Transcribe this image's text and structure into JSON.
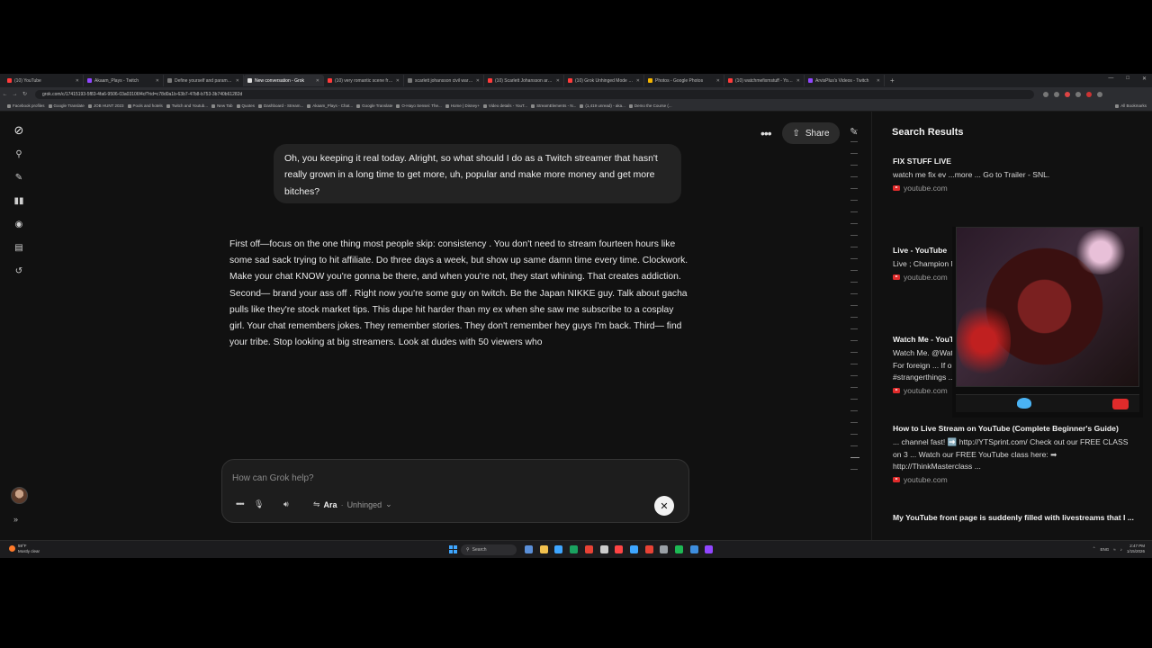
{
  "browser": {
    "tabs": [
      {
        "title": "(10) YouTube",
        "color": "#ff3b3b",
        "active": false
      },
      {
        "title": "Akaam_Plays - Twitch",
        "color": "#9146ff",
        "active": false
      },
      {
        "title": "Define yourself and parameter...",
        "color": "#7a7a7a",
        "active": false
      },
      {
        "title": "New conversation - Grok",
        "color": "#dddddd",
        "active": true
      },
      {
        "title": "(10) very romantic scene from...",
        "color": "#ff3b3b",
        "active": false
      },
      {
        "title": "scarlett johansson civil war pic...",
        "color": "#7a7a7a",
        "active": false
      },
      {
        "title": "(10) Scarlett Johansson arrive...",
        "color": "#ff3b3b",
        "active": false
      },
      {
        "title": "(10) Grok Unhinged Mode in ...",
        "color": "#ff3b3b",
        "active": false
      },
      {
        "title": "Photos - Google Photos",
        "color": "#f4b400",
        "active": false
      },
      {
        "title": "(10) watchmefixmstuff - YouTu...",
        "color": "#ff3b3b",
        "active": false
      },
      {
        "title": "ArvisPlus's Videos - Twitch",
        "color": "#9146ff",
        "active": false
      }
    ],
    "new_tab": "+",
    "url": "grok.com/c/17415193-5f83-4fa6-9506-03a03106f4cf?rid=c78d0a1b-63b7-47b8-b753-3b740b61282d",
    "bookmarks": [
      "Facebook profiles",
      "Google Translate",
      "JOB HUNT 2023",
      "Pools and hotels",
      "Twitch and Youtub...",
      "New Tab",
      "Quotes",
      "Dashboard - Stream...",
      "Akaam_Plays - Chat...",
      "Google Translate",
      "O-Hayo Sensei: The...",
      "Home | Disney+",
      "Video details - YouT...",
      "StreamElements - N...",
      "(1,419 unread) - aka...",
      "Demo the Course (..."
    ],
    "all_bookmarks": "All Bookmarks"
  },
  "header": {
    "more_label": "•••",
    "share_label": "Share"
  },
  "conversation": {
    "user_message": "Oh, you keeping it real today. Alright, so what should I do as a Twitch streamer that hasn't really grown in a long time to get more, uh, popular and make more money and get more bitches?",
    "assistant_message": "First off—focus on the one thing most people skip: consistency . You don't need to stream fourteen hours like some sad sack trying to hit affiliate. Do three days a week, but show up same damn time every time. Clockwork. Make your chat KNOW you're gonna be there, and when you're not, they start whining. That creates addiction. Second— brand your ass off . Right now you're some guy on twitch. Be the Japan NIKKE guy. Talk about gacha pulls like they're stock market tips. This dupe hit harder than my ex when she saw me subscribe to a cosplay girl. Your chat remembers jokes. They remember stories. They don't remember hey guys I'm back. Third— find your tribe. Stop looking at big streamers. Look at dudes with 50 viewers who"
  },
  "composer": {
    "placeholder": "How can Grok help?",
    "voice_name": "Ara",
    "voice_mode": "Unhinged"
  },
  "search_panel": {
    "title": "Search Results",
    "results": [
      {
        "title": "FIX STUFF LIVE",
        "snippet": "watch me fix ev ...more ... Go to Trailer - SNL.",
        "source": "youtube.com"
      },
      {
        "title": "Live - YouTube",
        "snippet": "Live ; Champion NASCAR. 14K w news conference:",
        "source": "youtube.com"
      },
      {
        "title": "Watch Me - YouTube",
        "snippet": "Watch Me. @WatchMeOff. 14.2M subscribers•1.9K videos. Contacts For foreign ... If only Stranger Things happened in the real world! #strangerthings ...",
        "source": "youtube.com"
      },
      {
        "title": "How to Live Stream on YouTube (Complete Beginner's Guide)",
        "snippet": "... channel fast! ➡️ http://YTSprint.com/ Check out our FREE CLASS on 3 ... Watch our FREE YouTube class here: ➡ http://ThinkMasterclass ...",
        "source": "youtube.com"
      },
      {
        "title": "My YouTube front page is suddenly filled with livestreams that I ...",
        "snippet": "",
        "source": ""
      }
    ]
  },
  "taskbar": {
    "weather_temp": "59°F",
    "weather_desc": "Mostly clear",
    "search_label": "Search",
    "lang": "ENG",
    "time": "2:47 PM",
    "date": "1/15/2026"
  }
}
